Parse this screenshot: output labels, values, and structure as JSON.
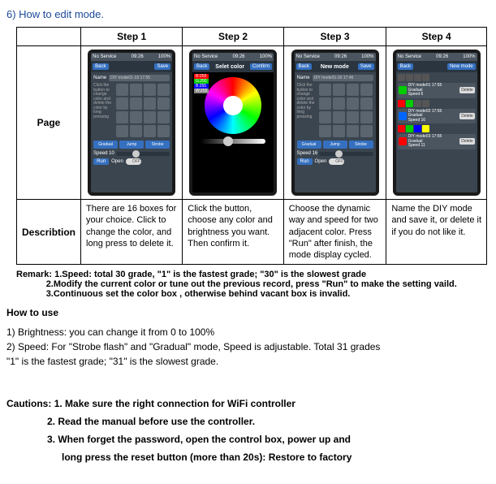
{
  "section_title": "6) How to edit mode.",
  "table": {
    "headers": [
      "",
      "Step 1",
      "Step 2",
      "Step 3",
      "Step 4"
    ],
    "row_page": "Page",
    "row_desc": "Describtion",
    "desc": [
      "There are 16 boxes for your choice. Click to change the color, and long press to delete it.",
      "Click the button, choose any color and brightness you want. Then confirm it.",
      "Choose the dynamic way and speed for two adjacent color. Press \"Run\" after finish, the mode display cycled.",
      "Name the DIY mode and save it, or delete it if you do not like it."
    ]
  },
  "remark": {
    "label": "Remark:",
    "line1": "1.Speed: total 30 grade, \"1\" is the fastest grade; \"30\" is the slowest grade",
    "line2": "2.Modify the current color or tune out the previous record, press \"Run\" to make the setting vaild.",
    "line3": "3.Continuous set the color box , otherwise behind vacant box is invalid."
  },
  "howto": {
    "title": "How to use",
    "line1": "1)  Brightness: you can change it from 0 to 100%",
    "line2": "2)  Speed: For \"Strobe flash\" and \"Gradual\" mode, Speed is adjustable. Total 31 grades",
    "line3": "\"1\" is the fastest grade; \"31\" is the slowest grade."
  },
  "cautions": {
    "label": "Cautions:",
    "c1": "1. Make sure the right connection for WiFi controller",
    "c2": "2. Read the manual before use the controller.",
    "c3": "3. When forget the password, open the control box, power up and",
    "c3b": "long press the reset button (more than 20s): Restore to factory"
  },
  "phone": {
    "status_left": "No Service",
    "status_time": "09:26",
    "status_batt": "100%",
    "back": "Back",
    "confirm": "Confirm",
    "save": "Save",
    "newmode": "New mode",
    "step1_title": "",
    "step2_title": "Selet color",
    "step3_title": "New mode",
    "name_label": "Name",
    "name_value1": "DIY mode01-19 17:55",
    "name_value3": "DIY mode01-26 17:46",
    "hint": "Click the button to change color and delete the color by long pressing",
    "gradual": "Gradual",
    "jump": "Jump",
    "strobe": "Strobe",
    "speed_label": "Speed 10",
    "speed_label3": "Speed 16",
    "run": "Run",
    "open": "Open",
    "off": "OFF",
    "color_r": "R:255",
    "color_g": "G:255",
    "color_b": "B:255",
    "color_w": "W:255",
    "list": [
      {
        "name": "DIY mode01 17:55",
        "sub": "Gradual",
        "spd": "Speed 6"
      },
      {
        "name": "DIY mode02 17:55",
        "sub": "Gradual",
        "spd": "Speed 16"
      },
      {
        "name": "DIY mode03 17:55",
        "sub": "Gradual",
        "spd": "Speed 11"
      }
    ],
    "delete": "Delete"
  }
}
